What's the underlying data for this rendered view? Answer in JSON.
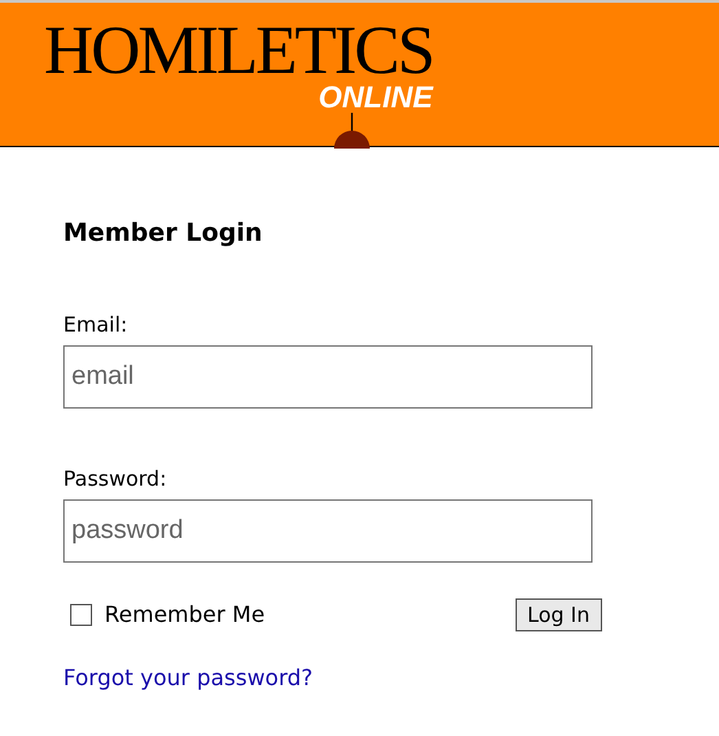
{
  "header": {
    "logo_title": "HOMILETICS",
    "logo_subtitle": "ONLINE"
  },
  "login": {
    "heading": "Member Login",
    "fields": [
      {
        "label": "Email:",
        "placeholder": "email"
      },
      {
        "label": "Password:",
        "placeholder": "password"
      }
    ],
    "remember": {
      "label": "Remember Me",
      "checked": false
    },
    "submit": "Log In",
    "forgot_link": "Forgot your password?"
  }
}
